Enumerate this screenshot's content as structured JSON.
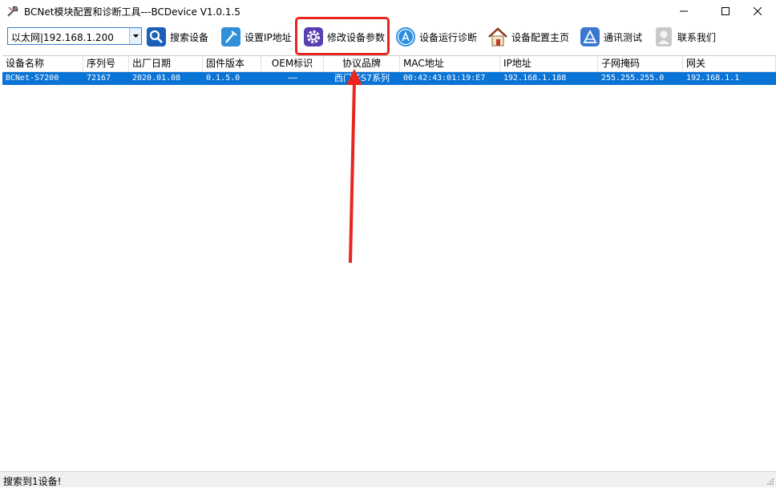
{
  "window": {
    "title": "BCNet模块配置和诊断工具---BCDevice V1.0.1.5",
    "minimize_glyph": "—",
    "maximize_glyph": "☐",
    "close_glyph": "✕"
  },
  "toolbar": {
    "combo_value": "以太网|192.168.1.200",
    "buttons": [
      {
        "label": "搜索设备",
        "icon": "search-icon"
      },
      {
        "label": "设置IP地址",
        "icon": "wand-icon"
      },
      {
        "label": "修改设备参数",
        "icon": "gear-icon"
      },
      {
        "label": "设备运行诊断",
        "icon": "app-store-icon"
      },
      {
        "label": "设备配置主页",
        "icon": "home-icon"
      },
      {
        "label": "通讯测试",
        "icon": "triangle-tool-icon"
      },
      {
        "label": "联系我们",
        "icon": "contact-icon"
      }
    ]
  },
  "table": {
    "columns": [
      "设备名称",
      "序列号",
      "出厂日期",
      "固件版本",
      "OEM标识",
      "协议品牌",
      "MAC地址",
      "IP地址",
      "子网掩码",
      "网关"
    ],
    "rows": [
      [
        "BCNet-S7200",
        "72167",
        "2020.01.08",
        "0.1.5.0",
        "——",
        "西门子S7系列",
        "00:42:43:01:19:E7",
        "192.168.1.188",
        "255.255.255.0",
        "192.168.1.1"
      ]
    ]
  },
  "status": {
    "text": "搜索到1设备!"
  },
  "colors": {
    "selection": "#0a74d6",
    "highlight_box": "#e8261f",
    "arrow": "#e8261f"
  }
}
